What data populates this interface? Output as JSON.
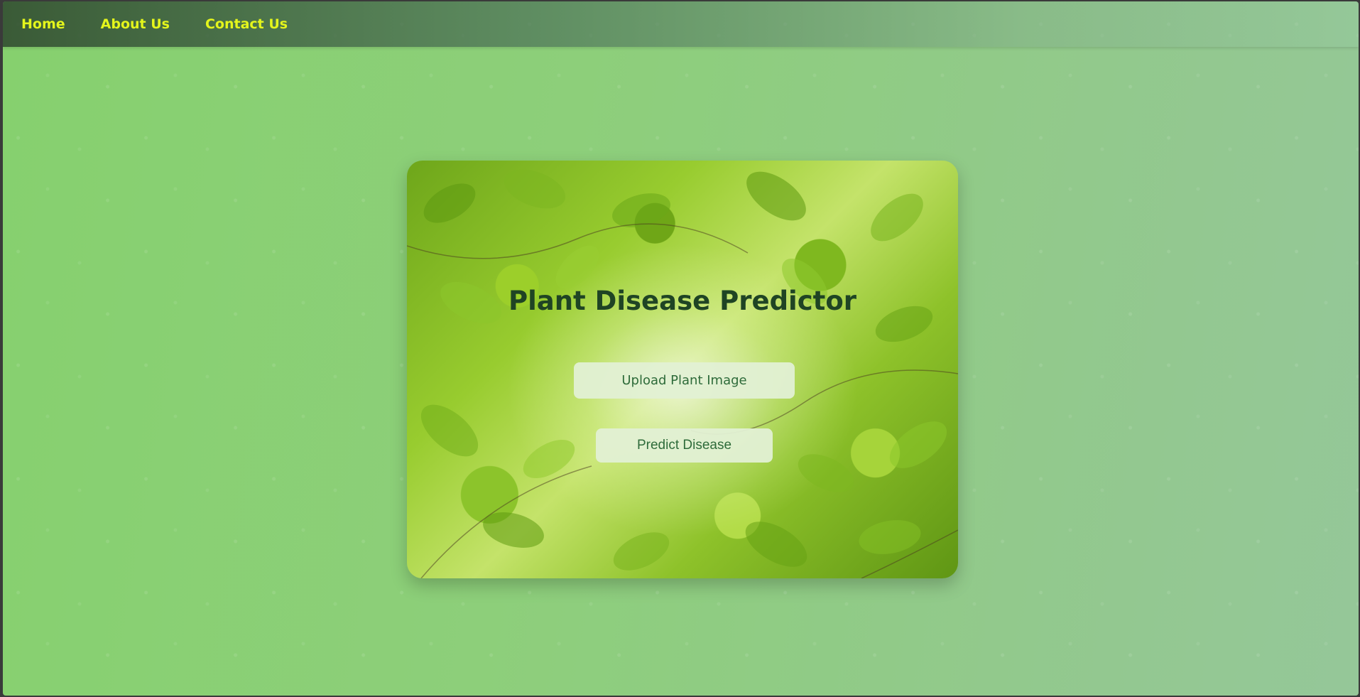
{
  "nav": {
    "items": [
      {
        "label": "Home"
      },
      {
        "label": "About Us"
      },
      {
        "label": "Contact Us"
      }
    ]
  },
  "card": {
    "title": "Plant Disease Predictor",
    "upload_label": "Upload Plant Image",
    "predict_label": "Predict Disease"
  },
  "colors": {
    "nav_link": "#e4f51c",
    "title": "#1f4424",
    "button_bg": "#e1f0d4",
    "button_text": "#2e6b3a"
  }
}
